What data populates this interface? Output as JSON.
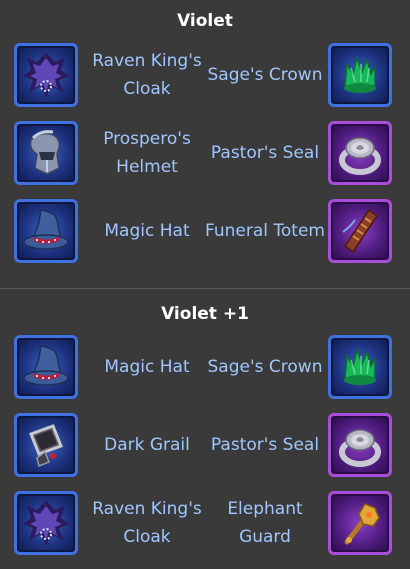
{
  "sections": [
    {
      "title": "Violet",
      "rows": [
        {
          "left": {
            "label": "Raven King's Cloak",
            "icon": "raven-cloak-icon"
          },
          "right": {
            "label": "Sage's Crown",
            "icon": "green-crown-icon"
          }
        },
        {
          "left": {
            "label": "Prospero's Helmet",
            "icon": "helmet-icon"
          },
          "right": {
            "label": "Pastor's Seal",
            "icon": "seal-ring-icon"
          }
        },
        {
          "left": {
            "label": "Magic Hat",
            "icon": "wizard-hat-icon"
          },
          "right": {
            "label": "Funeral Totem",
            "icon": "totem-icon"
          }
        }
      ]
    },
    {
      "title": "Violet +1",
      "rows": [
        {
          "left": {
            "label": "Magic Hat",
            "icon": "wizard-hat-icon"
          },
          "right": {
            "label": "Sage's Crown",
            "icon": "green-crown-icon"
          }
        },
        {
          "left": {
            "label": "Dark Grail",
            "icon": "grail-icon"
          },
          "right": {
            "label": "Pastor's Seal",
            "icon": "seal-ring-icon"
          }
        },
        {
          "left": {
            "label": "Raven King's Cloak",
            "icon": "raven-cloak-icon"
          },
          "right": {
            "label": "Elephant Guard",
            "icon": "mace-icon"
          }
        }
      ]
    }
  ]
}
